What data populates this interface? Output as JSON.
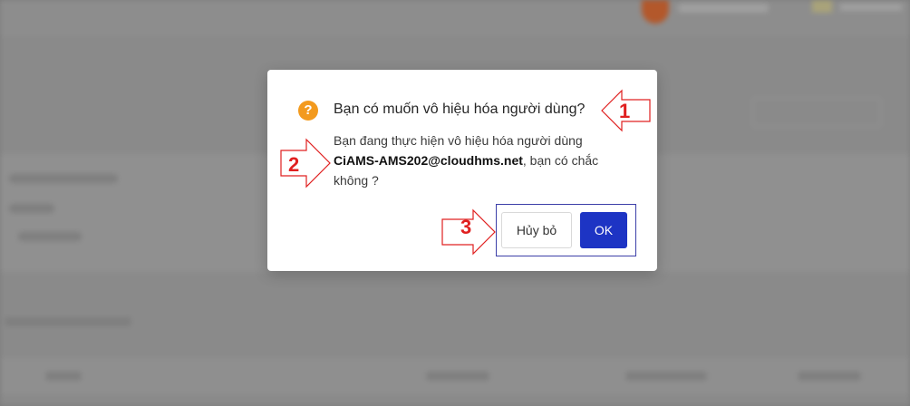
{
  "dialog": {
    "title": "Bạn có muốn vô hiệu hóa người dùng?",
    "message_prefix": "Bạn đang thực hiện vô hiệu hóa người dùng",
    "user_email": "CiAMS-AMS202@cloudhms.net",
    "message_suffix": ", bạn có chắc không ?",
    "cancel_label": "Hủy bỏ",
    "ok_label": "OK",
    "icon": "question-icon",
    "icon_glyph": "?"
  },
  "annotations": {
    "marker_1": "1",
    "marker_2": "2",
    "marker_3": "3",
    "color": "#e02020"
  },
  "colors": {
    "accent": "#1d34c4",
    "warning": "#f39a1e"
  }
}
